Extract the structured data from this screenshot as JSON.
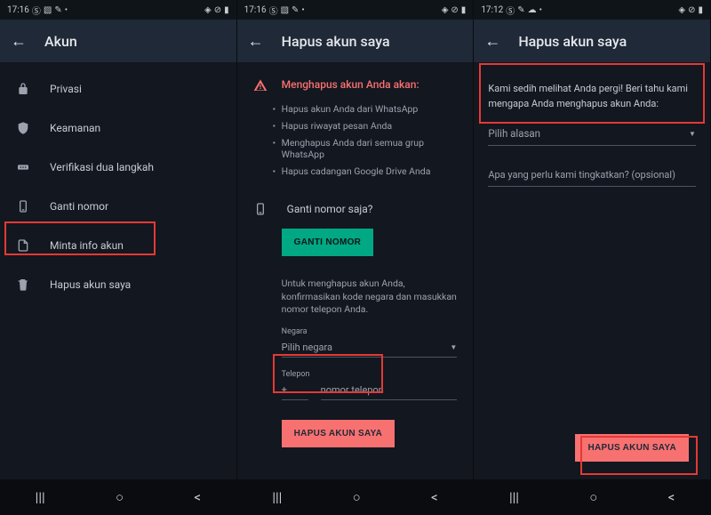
{
  "screens": [
    {
      "statusbar": {
        "time": "17:16"
      },
      "appbar": {
        "title": "Akun"
      },
      "menu": [
        {
          "label": "Privasi"
        },
        {
          "label": "Keamanan"
        },
        {
          "label": "Verifikasi dua langkah"
        },
        {
          "label": "Ganti nomor"
        },
        {
          "label": "Minta info akun"
        },
        {
          "label": "Hapus akun saya"
        }
      ]
    },
    {
      "statusbar": {
        "time": "17:16"
      },
      "appbar": {
        "title": "Hapus akun saya"
      },
      "warning_title": "Menghapus akun Anda akan:",
      "bullets": [
        "Hapus akun Anda dari WhatsApp",
        "Hapus riwayat pesan Anda",
        "Menghapus Anda dari semua grup WhatsApp",
        "Hapus cadangan Google Drive Anda"
      ],
      "change_number_q": "Ganti nomor saja?",
      "change_number_btn": "GANTI NOMOR",
      "confirm_text": "Untuk menghapus akun Anda, konfirmasikan kode negara dan masukkan nomor telepon Anda.",
      "country_label": "Negara",
      "country_placeholder": "Pilih negara",
      "phone_label": "Telepon",
      "phone_prefix": "+",
      "phone_placeholder": "nomor telepon",
      "delete_btn": "HAPUS AKUN SAYA"
    },
    {
      "statusbar": {
        "time": "17:12"
      },
      "appbar": {
        "title": "Hapus akun saya"
      },
      "sad_text": "Kami sedih melihat Anda pergi! Beri tahu kami mengapa Anda menghapus akun Anda:",
      "reason_placeholder": "Pilih alasan",
      "feedback_placeholder": "Apa yang perlu kami tingkatkan? (opsional)",
      "delete_btn": "HAPUS AKUN SAYA"
    }
  ]
}
